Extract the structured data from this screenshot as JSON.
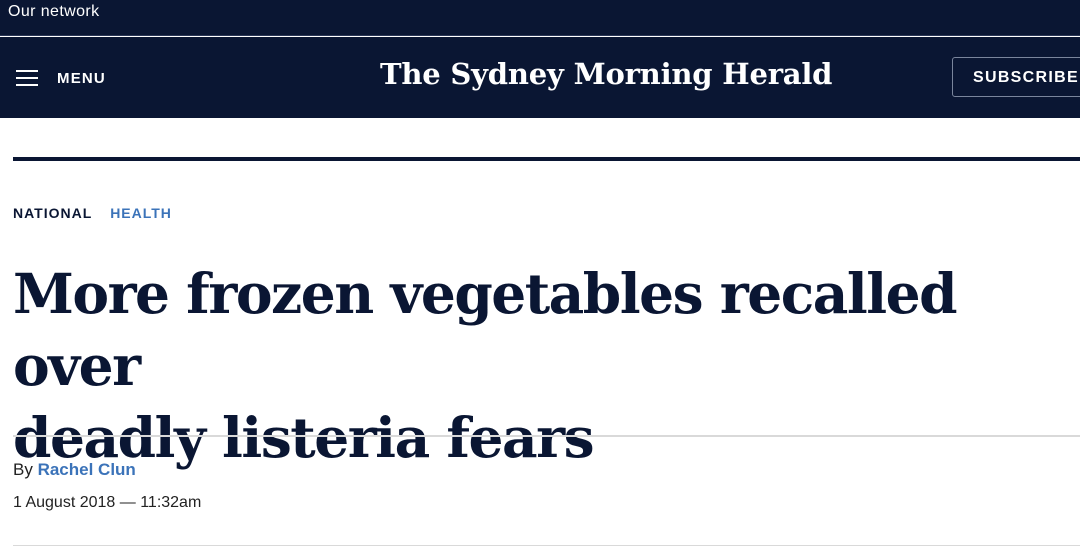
{
  "topbar": {
    "network_label": "Our network"
  },
  "header": {
    "menu_label": "MENU",
    "logo_text": "The Sydney Morning Herald",
    "subscribe_label": "SUBSCRIBE"
  },
  "article": {
    "tags": [
      "NATIONAL",
      "HEALTH"
    ],
    "headline_line1": "More frozen vegetables recalled over",
    "headline_line2": "deadly listeria fears",
    "byline_prefix": "By",
    "author": "Rachel Clun",
    "date": "1 August 2018 — 11:32am"
  },
  "colors": {
    "brand_navy": "#0a1633",
    "link_blue": "#3b73b9",
    "divider_grey": "#d9d9d9"
  },
  "icons": {
    "menu": "hamburger-icon"
  }
}
